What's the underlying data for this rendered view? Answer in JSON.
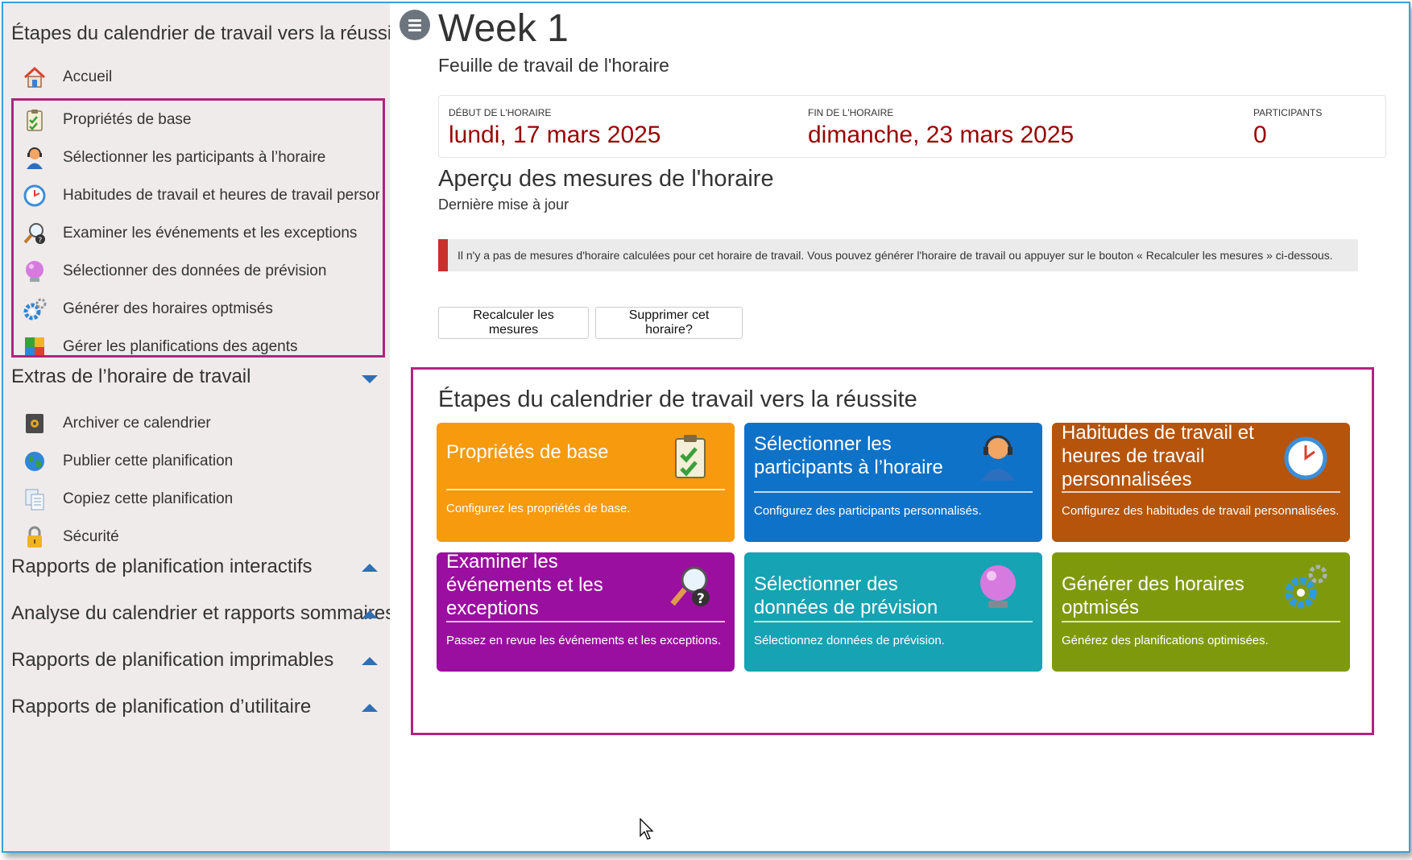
{
  "sidebar": {
    "heading": "Étapes du calendrier de travail vers la réussite",
    "items": [
      {
        "label": "Accueil",
        "icon": "home-icon"
      },
      {
        "label": "Propriétés de base",
        "icon": "clipboard-check-icon"
      },
      {
        "label": "Sélectionner les participants à l’horaire",
        "icon": "agent-headset-icon"
      },
      {
        "label": "Habitudes de travail et heures de travail personnalisées",
        "icon": "clock-icon"
      },
      {
        "label": "Examiner les événements et les exceptions",
        "icon": "magnifier-question-icon"
      },
      {
        "label": "Sélectionner des données de prévision",
        "icon": "crystal-ball-icon"
      },
      {
        "label": "Générer des horaires optmisés",
        "icon": "gears-icon"
      },
      {
        "label": "Gérer les planifications des agents",
        "icon": "puzzle-icon"
      }
    ],
    "extras_heading": "Extras de l’horaire de travail",
    "extras": [
      {
        "label": "Archiver ce calendrier",
        "icon": "safe-icon"
      },
      {
        "label": "Publier cette planification",
        "icon": "globe-icon"
      },
      {
        "label": "Copiez cette planification",
        "icon": "copy-documents-icon"
      },
      {
        "label": "Sécurité",
        "icon": "lock-icon"
      }
    ],
    "sections": [
      "Rapports de planification interactifs",
      "Analyse du calendrier et rapports sommaires",
      "Rapports de planification imprimables",
      "Rapports de planification d’utilitaire"
    ]
  },
  "header": {
    "title": "Week 1",
    "subtitle": "Feuille de travail de l'horaire"
  },
  "stats": {
    "start_label": "DÉBUT DE L'HORAIRE",
    "start_value": "lundi, 17 mars 2025",
    "end_label": "FIN DE L'HORAIRE",
    "end_value": "dimanche, 23 mars 2025",
    "participants_label": "PARTICIPANTS",
    "participants_value": "0",
    "value_color": "#990000"
  },
  "overview": {
    "title": "Aperçu des mesures de l'horaire",
    "updated": "Dernière mise à jour",
    "alert": "Il n'y a pas de mesures d'horaire calculées pour cet horaire de travail. Vous pouvez générer l'horaire de travail ou appuyer sur le bouton « Recalculer les mesures » ci-dessous.",
    "alert_color": "#c9302c"
  },
  "buttons": {
    "recalc": "Recalculer les mesures",
    "delete": "Supprimer cet horaire?"
  },
  "steps": {
    "title": "Étapes du calendrier de travail vers la réussite",
    "tiles": [
      {
        "title": "Propriétés de base",
        "desc": "Configurez les propriétés de base.",
        "color": "#f79a0e",
        "icon": "clipboard-check-icon"
      },
      {
        "title": "Sélectionner les participants à l’horaire",
        "desc": "Configurez des participants personnalisés.",
        "color": "#0e72c8",
        "icon": "agent-headset-icon"
      },
      {
        "title": "Habitudes de travail et heures de travail personnalisées",
        "desc": "Configurez des habitudes de travail personnalisées.",
        "color": "#b5540a",
        "icon": "clock-icon"
      },
      {
        "title": "Examiner les événements et les exceptions",
        "desc": "Passez en revue les événements et les exceptions.",
        "color": "#9a0f9f",
        "icon": "magnifier-question-icon"
      },
      {
        "title": "Sélectionner des données de prévision",
        "desc": "Sélectionnez données de prévision.",
        "color": "#16a3b3",
        "icon": "crystal-ball-icon"
      },
      {
        "title": "Générer des horaires optmisés",
        "desc": "Générez des planifications optimisées.",
        "color": "#7e9a0c",
        "icon": "gears-icon"
      }
    ]
  }
}
